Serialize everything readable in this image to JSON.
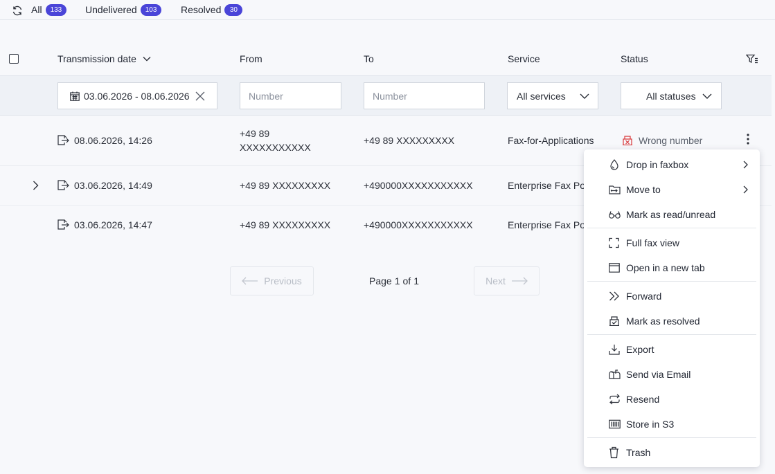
{
  "tabs": [
    {
      "label": "All",
      "count": "133"
    },
    {
      "label": "Undelivered",
      "count": "103"
    },
    {
      "label": "Resolved",
      "count": "30"
    }
  ],
  "columns": {
    "date": "Transmission date",
    "from": "From",
    "to": "To",
    "service": "Service",
    "status": "Status"
  },
  "filters": {
    "date_range": "03.06.2026 - 08.06.2026",
    "from_placeholder": "Number",
    "to_placeholder": "Number",
    "service": "All services",
    "status": "All statuses"
  },
  "rows": [
    {
      "date": "08.06.2026, 14:26",
      "from_line1": "+49 89",
      "from_line2": "XXXXXXXXXXX",
      "to": "+49 89 XXXXXXXXX",
      "service": "Fax-for-Applications",
      "status": "Wrong number"
    },
    {
      "date": "03.06.2026, 14:49",
      "from": "+49 89 XXXXXXXXX",
      "to": "+490000XXXXXXXXXXX",
      "service": "Enterprise Fax Po"
    },
    {
      "date": "03.06.2026, 14:47",
      "from": "+49 89 XXXXXXXXX",
      "to": "+490000XXXXXXXXXXX",
      "service": "Enterprise Fax Po"
    }
  ],
  "pagination": {
    "previous": "Previous",
    "page_prefix": "Page",
    "page": "1",
    "of": "of",
    "total": "1",
    "next": "Next"
  },
  "menu": {
    "drop_in_faxbox": "Drop in faxbox",
    "move_to": "Move to",
    "mark_read_unread": "Mark as read/unread",
    "full_fax_view": "Full fax view",
    "open_new_tab": "Open in a new tab",
    "forward": "Forward",
    "mark_resolved": "Mark as resolved",
    "export": "Export",
    "send_email": "Send via Email",
    "resend": "Resend",
    "store_s3": "Store in S3",
    "trash": "Trash"
  },
  "colors": {
    "accent": "#4a45d8",
    "error": "#d9383a",
    "text": "#2b2f38"
  }
}
